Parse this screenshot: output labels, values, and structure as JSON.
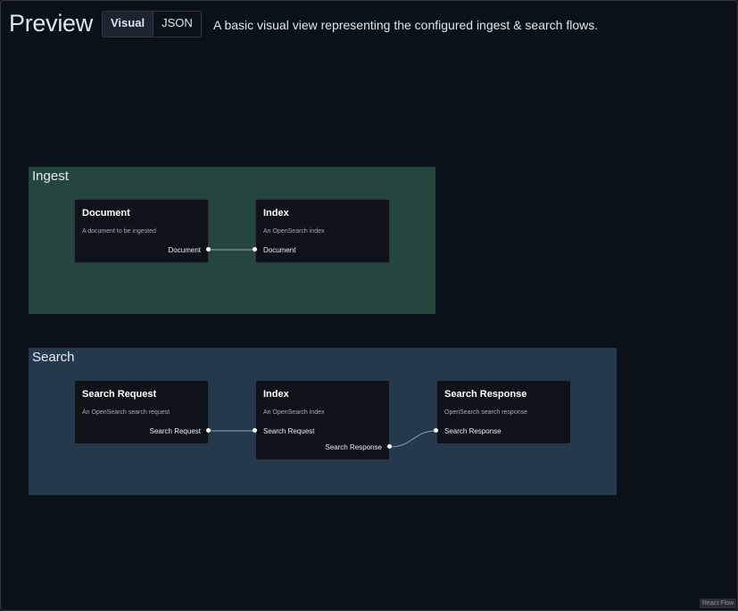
{
  "header": {
    "title": "Preview",
    "tabs": [
      {
        "label": "Visual",
        "active": true
      },
      {
        "label": "JSON",
        "active": false
      }
    ],
    "description": "A basic visual view representing the configured ingest & search flows."
  },
  "ingest": {
    "label": "Ingest",
    "document_node": {
      "title": "Document",
      "description": "A document to be ingested",
      "output": "Document"
    },
    "index_node": {
      "title": "Index",
      "description": "An OpenSearch index",
      "input": "Document"
    }
  },
  "search": {
    "label": "Search",
    "request_node": {
      "title": "Search Request",
      "description": "An OpenSearch search request",
      "output": "Search Request"
    },
    "index_node": {
      "title": "Index",
      "description": "An OpenSearch index",
      "input": "Search Request",
      "output": "Search Response"
    },
    "response_node": {
      "title": "Search Response",
      "description": "OpenSearch search response",
      "input": "Search Response"
    }
  },
  "attribution": "React Flow",
  "colors": {
    "background": "#0b1118",
    "ingest_group": "#25463f",
    "search_group": "#243a4c",
    "node": "#0e131a"
  }
}
